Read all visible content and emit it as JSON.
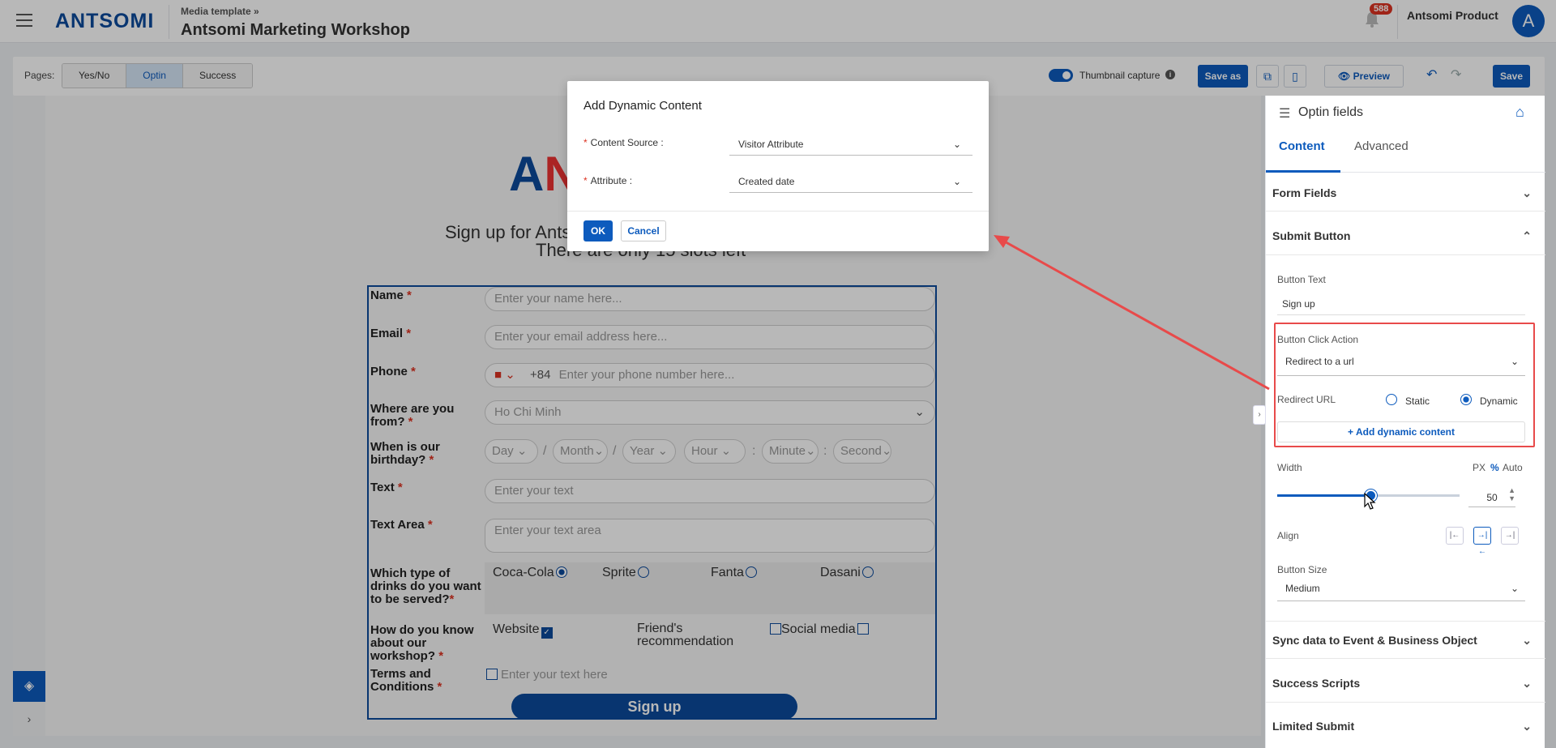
{
  "header": {
    "logo": "ANTSOMI",
    "breadcrumb": "Media template »",
    "title": "Antsomi Marketing Workshop",
    "notification_count": "588",
    "account": "Antsomi Product",
    "avatar": "A"
  },
  "toolbar": {
    "pages_label": "Pages:",
    "tabs": [
      "Yes/No",
      "Optin",
      "Success"
    ],
    "active_tab": "Optin",
    "thumbnail_label": "Thumbnail capture",
    "save_as": "Save as",
    "preview": "Preview",
    "save": "Save"
  },
  "canvas": {
    "logo": "ANTSOMI",
    "heading_line1": "Sign up for Antsomi Marketing Workshop",
    "heading_line2": "There are only 15 slots left",
    "form": {
      "name_label": "Name",
      "name_placeholder": "Enter your name here...",
      "email_label": "Email",
      "email_placeholder": "Enter your email address here...",
      "phone_label": "Phone",
      "phone_code": "+84",
      "phone_placeholder": "Enter your phone number here...",
      "from_label": "Where are you from?",
      "from_value": "Ho Chi Minh",
      "birthday_label": "When is our birthday?",
      "day": "Day",
      "month": "Month",
      "year": "Year",
      "hour": "Hour",
      "minute": "Minute",
      "second": "Second",
      "text_label": "Text",
      "text_placeholder": "Enter your text",
      "textarea_label": "Text Area",
      "textarea_placeholder": "Enter your text area",
      "drinks_label": "Which type of drinks do you want to be served?",
      "drinks": [
        "Coca-Cola",
        "Sprite",
        "Fanta",
        "Dasani"
      ],
      "know_label": "How do you know about our workshop?",
      "know": [
        "Website",
        "Friend's recommendation",
        "Social media"
      ],
      "terms_label": "Terms and Conditions",
      "terms_placeholder": "Enter your text here",
      "submit": "Sign up",
      "required_mark": "*"
    }
  },
  "panel": {
    "title": "Optin fields",
    "tab_content": "Content",
    "tab_advanced": "Advanced",
    "form_fields": "Form Fields",
    "submit_button": "Submit Button",
    "button_text_label": "Button Text",
    "button_text_value": "Sign up",
    "click_action_label": "Button Click Action",
    "click_action_value": "Redirect to a url",
    "redirect_label": "Redirect URL",
    "static": "Static",
    "dynamic": "Dynamic",
    "redirect_mode": "Dynamic",
    "add_dynamic": "+ Add dynamic content",
    "width_label": "Width",
    "unit_px": "PX",
    "unit_pct": "%",
    "unit_auto": "Auto",
    "width_value": "50",
    "align_label": "Align",
    "button_size_label": "Button Size",
    "button_size_value": "Medium",
    "sync": "Sync data to Event & Business Object",
    "success_scripts": "Success Scripts",
    "limited_submit": "Limited Submit"
  },
  "modal": {
    "title": "Add Dynamic Content",
    "source_label": "Content Source :",
    "source_value": "Visitor Attribute",
    "attribute_label": "Attribute :",
    "attribute_value": "Created date",
    "ok": "OK",
    "cancel": "Cancel"
  },
  "colors": {
    "accent": "#0d5bbd",
    "annotation": "#e84a4a",
    "badge": "#d32f2f"
  }
}
